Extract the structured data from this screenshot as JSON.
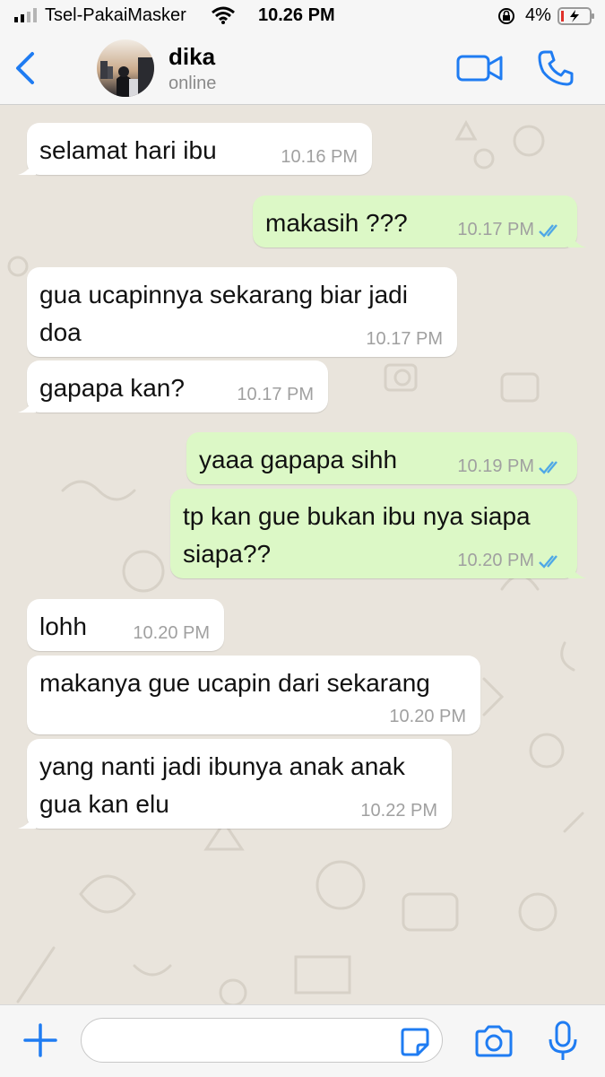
{
  "status_bar": {
    "carrier": "Tsel-PakaiMasker",
    "time": "10.26 PM",
    "battery": "4%"
  },
  "header": {
    "contact_name": "dika",
    "contact_status": "online",
    "back_icon": "chevron-left-icon",
    "video_icon": "video-camera-icon",
    "call_icon": "phone-icon"
  },
  "messages": [
    {
      "direction": "in",
      "text": "selamat hari ibu",
      "time": "10.16 PM"
    },
    {
      "direction": "out",
      "text": "makasih ???",
      "time": "10.17 PM",
      "read": true
    },
    {
      "direction": "in",
      "text": "gua ucapinnya sekarang biar jadi doa",
      "time": "10.17 PM"
    },
    {
      "direction": "in",
      "text": "gapapa kan?",
      "time": "10.17 PM"
    },
    {
      "direction": "out",
      "text": "yaaa gapapa sihh",
      "time": "10.19 PM",
      "read": true
    },
    {
      "direction": "out",
      "text": "tp kan gue bukan ibu nya siapa siapa??",
      "time": "10.20 PM",
      "read": true
    },
    {
      "direction": "in",
      "text": "lohh",
      "time": "10.20 PM"
    },
    {
      "direction": "in",
      "text": "makanya gue ucapin dari sekarang",
      "time": "10.20 PM"
    },
    {
      "direction": "in",
      "text": "yang nanti jadi ibunya anak anak gua kan elu",
      "time": "10.22 PM"
    }
  ],
  "input_bar": {
    "message_value": "",
    "plus_icon": "plus-icon",
    "sticker_icon": "sticker-icon",
    "camera_icon": "camera-icon",
    "mic_icon": "microphone-icon"
  },
  "colors": {
    "accent": "#1f7cf2",
    "incoming_bubble": "#ffffff",
    "outgoing_bubble": "#dcf8c6",
    "chat_background": "#e9e4dc",
    "read_ticks": "#4fa8e6"
  }
}
